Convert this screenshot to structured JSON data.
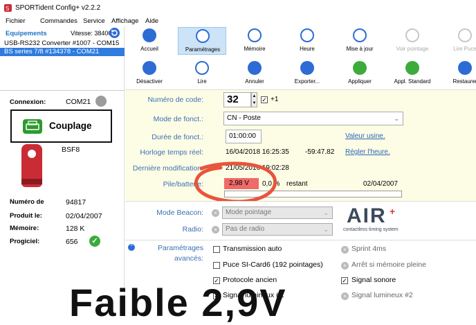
{
  "window": {
    "title": "SPORTident Config+ v2.2.2"
  },
  "menu": {
    "items": [
      "Fichier",
      "Commandes",
      "Service",
      "Affichage",
      "Aide"
    ]
  },
  "sidebar": {
    "title": "Equipements",
    "speed": "Vitesse: 38400",
    "devices": [
      "USB-RS232 Converter #1007 - COM15",
      "BS series 7/8 #134378 - COM21"
    ],
    "connexion_label": "Connexion:",
    "connexion_value": "COM21",
    "couplage_label": "Couplage",
    "model": "BSF8",
    "info": [
      {
        "label": "Numéro de",
        "value": "94817"
      },
      {
        "label": "Produit le:",
        "value": "02/04/2007"
      },
      {
        "label": "Mémoire:",
        "value": "128 K"
      },
      {
        "label": "Progiciel:",
        "value": "656"
      }
    ]
  },
  "toolbar": {
    "row1": [
      {
        "label": "Accueil",
        "icon": "home-icon",
        "color": "#2d6cd4"
      },
      {
        "label": "Paramétrages",
        "icon": "settings-card-icon",
        "color": "#2d6cd4"
      },
      {
        "label": "Mémoire",
        "icon": "memory-icon",
        "color": "#2d6cd4"
      },
      {
        "label": "Heure",
        "icon": "clock-icon",
        "color": "#2d6cd4"
      },
      {
        "label": "Mise à jour",
        "icon": "update-icon",
        "color": "#2d6cd4"
      },
      {
        "label": "Voir pointage",
        "icon": "view-punch-icon",
        "color": "#c8c8c8"
      },
      {
        "label": "Lire Puce",
        "icon": "read-chip-icon",
        "color": "#c8c8c8"
      }
    ],
    "row2": [
      {
        "label": "Désactiver",
        "icon": "power-icon",
        "color": "#2d6cd4"
      },
      {
        "label": "Lire",
        "icon": "read-icon",
        "color": "#2d6cd4"
      },
      {
        "label": "Annuler",
        "icon": "undo-icon",
        "color": "#2d6cd4"
      },
      {
        "label": "Exporter...",
        "icon": "export-icon",
        "color": "#2d6cd4"
      },
      {
        "label": "Appliquer",
        "icon": "apply-check-icon",
        "color": "#3cab3c"
      },
      {
        "label": "Appl. Standard",
        "icon": "apply-standard-icon",
        "color": "#3cab3c"
      },
      {
        "label": "Restaurer",
        "icon": "restore-icon",
        "color": "#2d6cd4"
      }
    ]
  },
  "panel": {
    "code_label": "Numéro de code:",
    "code_value": "32",
    "code_plus": "+1",
    "mode_label": "Mode de fonct.:",
    "mode_value": "CN - Poste",
    "duree_label": "Durée de fonct.:",
    "duree_value": "01:00:00",
    "valeur_usine": "Valeur usine.",
    "horloge_label": "Horloge temps réel:",
    "horloge_value": "16/04/2018 16:25:35",
    "horloge_offset": "-59:47.82",
    "regler": "Régler l'heure.",
    "derniere_label": "Dernière modification:",
    "derniere_value": "21/05/2016 19:02:28",
    "pile_label": "Pile/batterie:",
    "pile_voltage": "2,98 V",
    "pile_percent": "0,0 %",
    "pile_restant": "restant",
    "pile_date": "02/04/2007",
    "battery_level": 0.0
  },
  "beacon": {
    "mode_label": "Mode Beacon:",
    "mode_value": "Mode pointage",
    "radio_label": "Radio:",
    "radio_value": "Pas de radio",
    "logo_text": "AIR",
    "logo_sub": "contactless timing system"
  },
  "params": {
    "label1": "Paramétrages",
    "label2": "avancés:",
    "options_left": [
      {
        "label": "Transmission auto",
        "checked": false
      },
      {
        "label": "Puce SI-Card6 (192 pointages)",
        "checked": false
      },
      {
        "label": "Protocole ancien",
        "checked": true
      },
      {
        "label": "Signal lumineux #1",
        "checked": true
      }
    ],
    "options_right": [
      {
        "label": "Sprint 4ms"
      },
      {
        "label": "Arrêt si mémoire pleine"
      },
      {
        "label": "Signal sonore"
      },
      {
        "label": "Signal lumineux #2"
      }
    ]
  },
  "overlay_text": "Faible 2,9V"
}
